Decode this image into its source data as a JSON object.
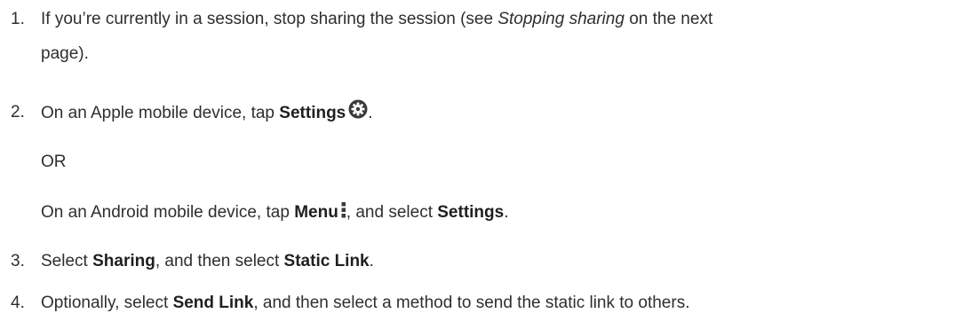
{
  "steps": [
    {
      "number": "1.",
      "line1": "If you’re currently in a session, stop sharing the session (see ",
      "link_italic": "Stopping sharing",
      "line1_end": " on the next",
      "line2": "page)."
    },
    {
      "number": "2.",
      "pre": "On an Apple mobile device, tap ",
      "bold": "Settings",
      "post": ".",
      "icon": "gear-icon"
    },
    {
      "or": "OR"
    },
    {
      "pre": "On an Android mobile device, tap ",
      "bold1": "Menu",
      "mid": ", and select ",
      "bold2": "Settings",
      "post": ".",
      "icon": "vertical-dots-menu-icon"
    },
    {
      "number": "3.",
      "pre": "Select ",
      "bold1": "Sharing",
      "mid": ", and then select ",
      "bold2": "Static Link",
      "post": "."
    },
    {
      "number": "4.",
      "pre": "Optionally, select ",
      "bold1": "Send Link",
      "post": ", and then select a method to send the static link to others."
    }
  ],
  "colors": {
    "text": "#2e2e2e",
    "icon": "#3a3a3a"
  }
}
